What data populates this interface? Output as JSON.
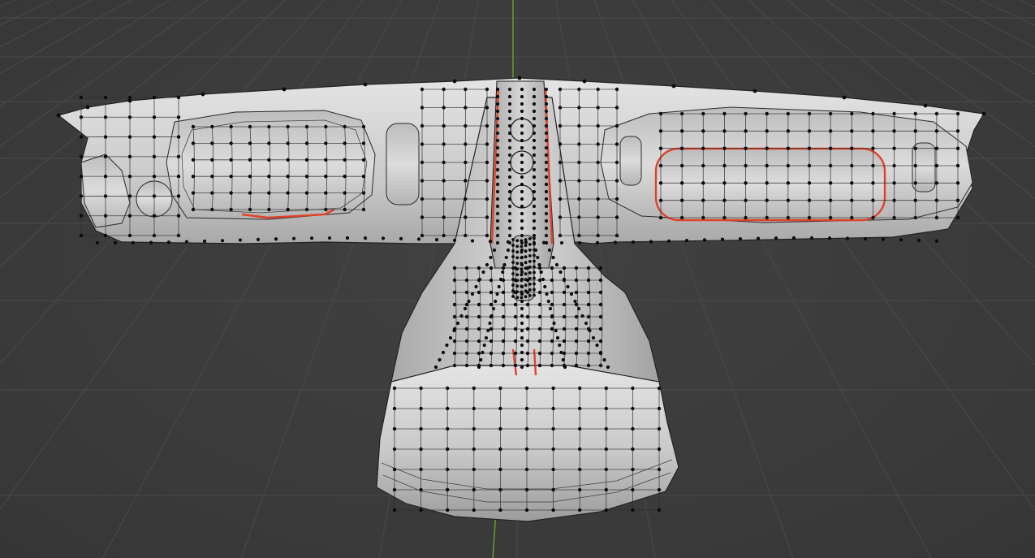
{
  "viewport": {
    "background": "#3d3d3d",
    "grid_color": "#4a4a4a",
    "axis_y_color": "#6aa22e",
    "mesh_color": "#cfcfcf",
    "vertex_color": "#0b0b0b",
    "seam_color": "#e0412a",
    "mode": "edit-mode-vertex-select",
    "object": "mesh-model"
  }
}
